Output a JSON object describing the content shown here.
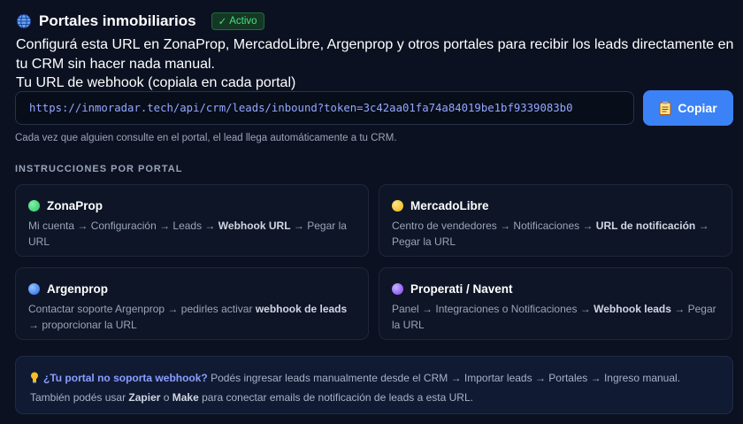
{
  "header": {
    "title": "Portales inmobiliarios",
    "status_badge": "Activo",
    "icon": "globe-icon"
  },
  "description": "Configurá esta URL en ZonaProp, MercadoLibre, Argenprop y otros portales para recibir los leads directamente en tu CRM sin hacer nada manual.",
  "webhook": {
    "label": "Tu URL de webhook (copiala en cada portal)",
    "url": "https://inmoradar.tech/api/crm/leads/inbound?token=3c42aa01fa74a84019be1bf9339083b0",
    "copy_label": "Copiar",
    "hint": "Cada vez que alguien consulte en el portal, el lead llega automáticamente a tu CRM."
  },
  "instructions": {
    "heading": "INSTRUCCIONES POR PORTAL",
    "portals": [
      {
        "name": "ZonaProp",
        "color": "#4ade80",
        "pre": "Mi cuenta → Configuración → Leads → ",
        "bold": "Webhook URL",
        "post": " → Pegar la URL"
      },
      {
        "name": "MercadoLibre",
        "color": "#facc15",
        "pre": "Centro de vendedores → Notificaciones → ",
        "bold": "URL de notificación",
        "post": " → Pegar la URL"
      },
      {
        "name": "Argenprop",
        "color": "#3b82f6",
        "pre": "Contactar soporte Argenprop → pedirles activar ",
        "bold": "webhook de leads",
        "post": " → proporcionar la URL"
      },
      {
        "name": "Properati / Navent",
        "color": "#a78bfa",
        "pre": "Panel → Integraciones o Notificaciones → ",
        "bold": "Webhook leads",
        "post": " → Pegar la URL"
      }
    ]
  },
  "tip": {
    "question": "¿Tu portal no soporta webhook?",
    "text1": " Podés ingresar leads manualmente desde el CRM → Importar leads → Portales → Ingreso manual.",
    "text2a": "También podés usar ",
    "zapier": "Zapier",
    "text2b": " o ",
    "make": "Make",
    "text2c": " para conectar emails de notificación de leads a esta URL."
  },
  "colors": {
    "accent": "#3b82f6",
    "success": "#4ade80",
    "background": "#0b1121"
  }
}
